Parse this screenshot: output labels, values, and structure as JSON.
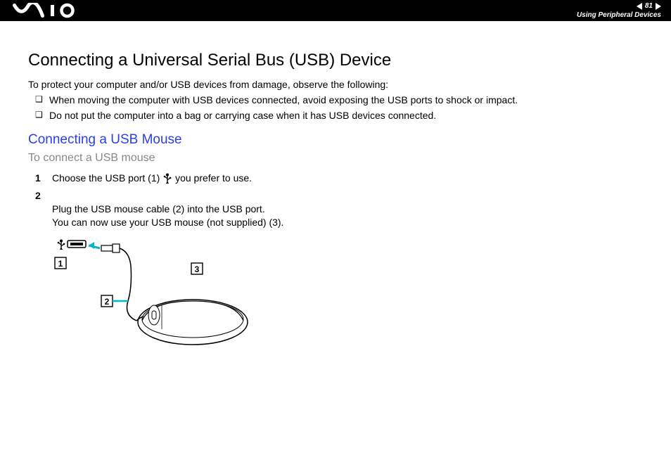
{
  "header": {
    "page_number": "81",
    "section": "Using Peripheral Devices"
  },
  "main": {
    "title": "Connecting a Universal Serial Bus (USB) Device",
    "intro": "To protect your computer and/or USB devices from damage, observe the following:",
    "bullets": [
      "When moving the computer with USB devices connected, avoid exposing the USB ports to shock or impact.",
      "Do not put the computer into a bag or carrying case when it has USB devices connected."
    ],
    "subsection": {
      "heading": "Connecting a USB Mouse",
      "task": "To connect a USB mouse",
      "steps": [
        {
          "pre": "Choose the USB port (1) ",
          "post": " you prefer to use."
        },
        {
          "pre": "Plug the USB mouse cable (2) into the USB port.\nYou can now use your USB mouse (not supplied) (3).",
          "post": ""
        }
      ]
    },
    "diagram_callouts": {
      "one": "1",
      "two": "2",
      "three": "3"
    }
  }
}
